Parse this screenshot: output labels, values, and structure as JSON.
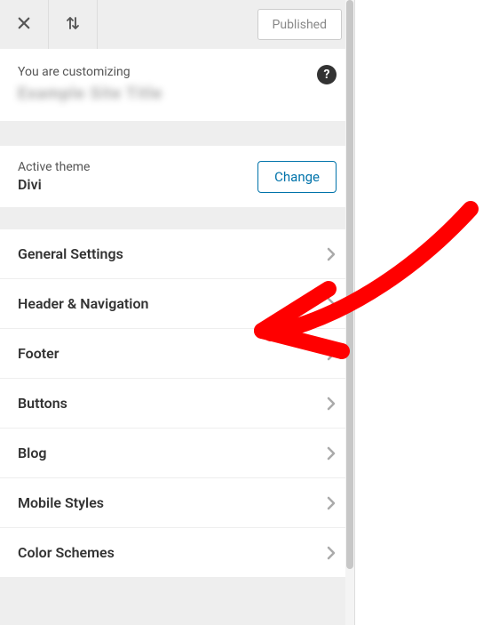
{
  "topbar": {
    "close_label": "close",
    "device_label": "device-preview",
    "published_label": "Published"
  },
  "customizing": {
    "label": "You are customizing",
    "site_name": "Example Site Title",
    "help_tooltip": "?"
  },
  "theme": {
    "label": "Active theme",
    "name": "Divi",
    "change_label": "Change"
  },
  "menu": {
    "items": [
      {
        "label": "General Settings"
      },
      {
        "label": "Header & Navigation"
      },
      {
        "label": "Footer"
      },
      {
        "label": "Buttons"
      },
      {
        "label": "Blog"
      },
      {
        "label": "Mobile Styles"
      },
      {
        "label": "Color Schemes"
      }
    ]
  },
  "annotation": {
    "color": "#ff0000"
  }
}
